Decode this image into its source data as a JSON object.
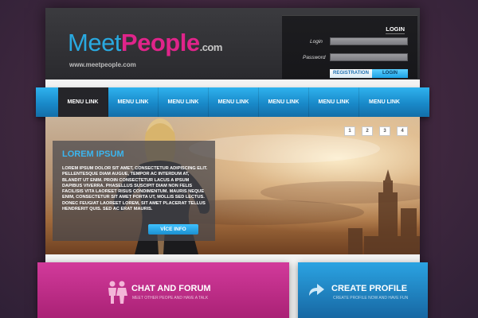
{
  "header": {
    "logo": {
      "meet": "Meet",
      "people": "People",
      "dotcom": ".com"
    },
    "site_url": "www.meetpeople.com"
  },
  "login": {
    "title": "LOGIN",
    "login_label": "Login",
    "password_label": "Password",
    "login_value": "",
    "password_value": "",
    "registration_button": "REGISTRATION",
    "login_button": "LOGIN"
  },
  "nav": {
    "items": [
      {
        "label": "MENU LINK",
        "active": true
      },
      {
        "label": "MENU LINK",
        "active": false
      },
      {
        "label": "MENU LINK",
        "active": false
      },
      {
        "label": "MENU LINK",
        "active": false
      },
      {
        "label": "MENU LINK",
        "active": false
      },
      {
        "label": "MENU LINK",
        "active": false
      },
      {
        "label": "MENU LINK",
        "active": false
      }
    ]
  },
  "hero": {
    "pagination": [
      "1",
      "2",
      "3",
      "4"
    ],
    "title": "LOREM IPSUM",
    "body": "LOREM IPSUM DOLOR SIT AMET, CONSECTETUR ADIPISCING ELIT. PELLENTESQUE DIAM AUGUE, TEMPOR AC INTERDUM AT, BLANDIT UT ENIM. PROIN CONSECTETUR LACUS A IPSUM DAPIBUS VIVERRA. PHASELLUS SUSCIPIT DIAM NON FELIS FACILISIS VITA LAOREET RISUS CONDIMENTUM. MAURIS NEQUE ENIM, CONSECTETUR SIT AMET PORTA UT, MOLLIS SED LECTUS. DONEC FEUGIAT LAOREET LOREM, SIT AMET PLACERAT TELLUS HENDRERIT QUIS. SED AC ERAT MAURIS.",
    "button": "VÍCE INFO"
  },
  "features": {
    "chat": {
      "title": "CHAT AND FORUM",
      "subtitle": "MEET OTHER PEOPE AND HAVE A TALK",
      "icon": "people-icon"
    },
    "profile": {
      "title": "CREATE PROFILE",
      "subtitle": "CREATE PROFILE NOW AND HAVE FUN",
      "icon": "arrow-icon"
    }
  },
  "colors": {
    "accent_blue": "#29a9e0",
    "accent_pink": "#e0248a",
    "background": "#40283f"
  }
}
